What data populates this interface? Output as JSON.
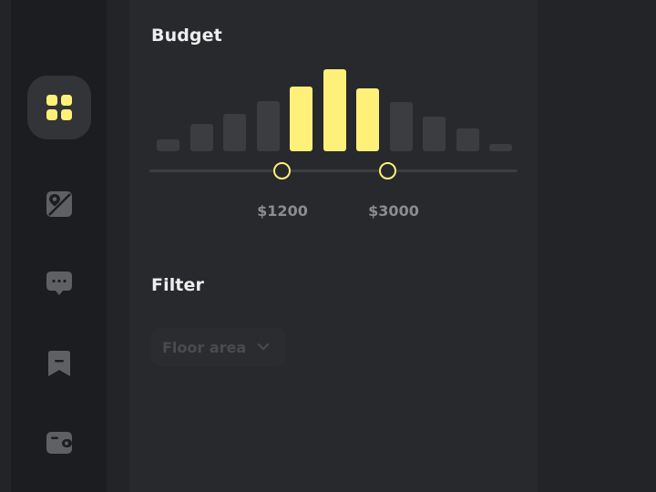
{
  "sidebar": {
    "items": [
      {
        "name": "dashboard",
        "icon": "dashboard-grid-icon",
        "active": true
      },
      {
        "name": "map",
        "icon": "map-pin-icon",
        "active": false
      },
      {
        "name": "messages",
        "icon": "chat-bubble-icon",
        "active": false
      },
      {
        "name": "saved",
        "icon": "bookmark-icon",
        "active": false
      },
      {
        "name": "wallet",
        "icon": "wallet-icon",
        "active": false
      }
    ]
  },
  "budget": {
    "title": "Budget",
    "min_label": "$1200",
    "max_label": "$3000",
    "histogram": {
      "relative_heights": [
        0.14,
        0.33,
        0.45,
        0.61,
        0.79,
        1.0,
        0.77,
        0.6,
        0.42,
        0.28,
        0.09
      ],
      "selected_indices": [
        4,
        5,
        6
      ]
    }
  },
  "filter": {
    "title": "Filter",
    "dropdown_value": "Floor area"
  },
  "colors": {
    "accent": "#fff07a",
    "inactive_bar": "#3c3d40",
    "panel_bg": "#28292c",
    "sidebar_bg": "#1c1d20"
  }
}
